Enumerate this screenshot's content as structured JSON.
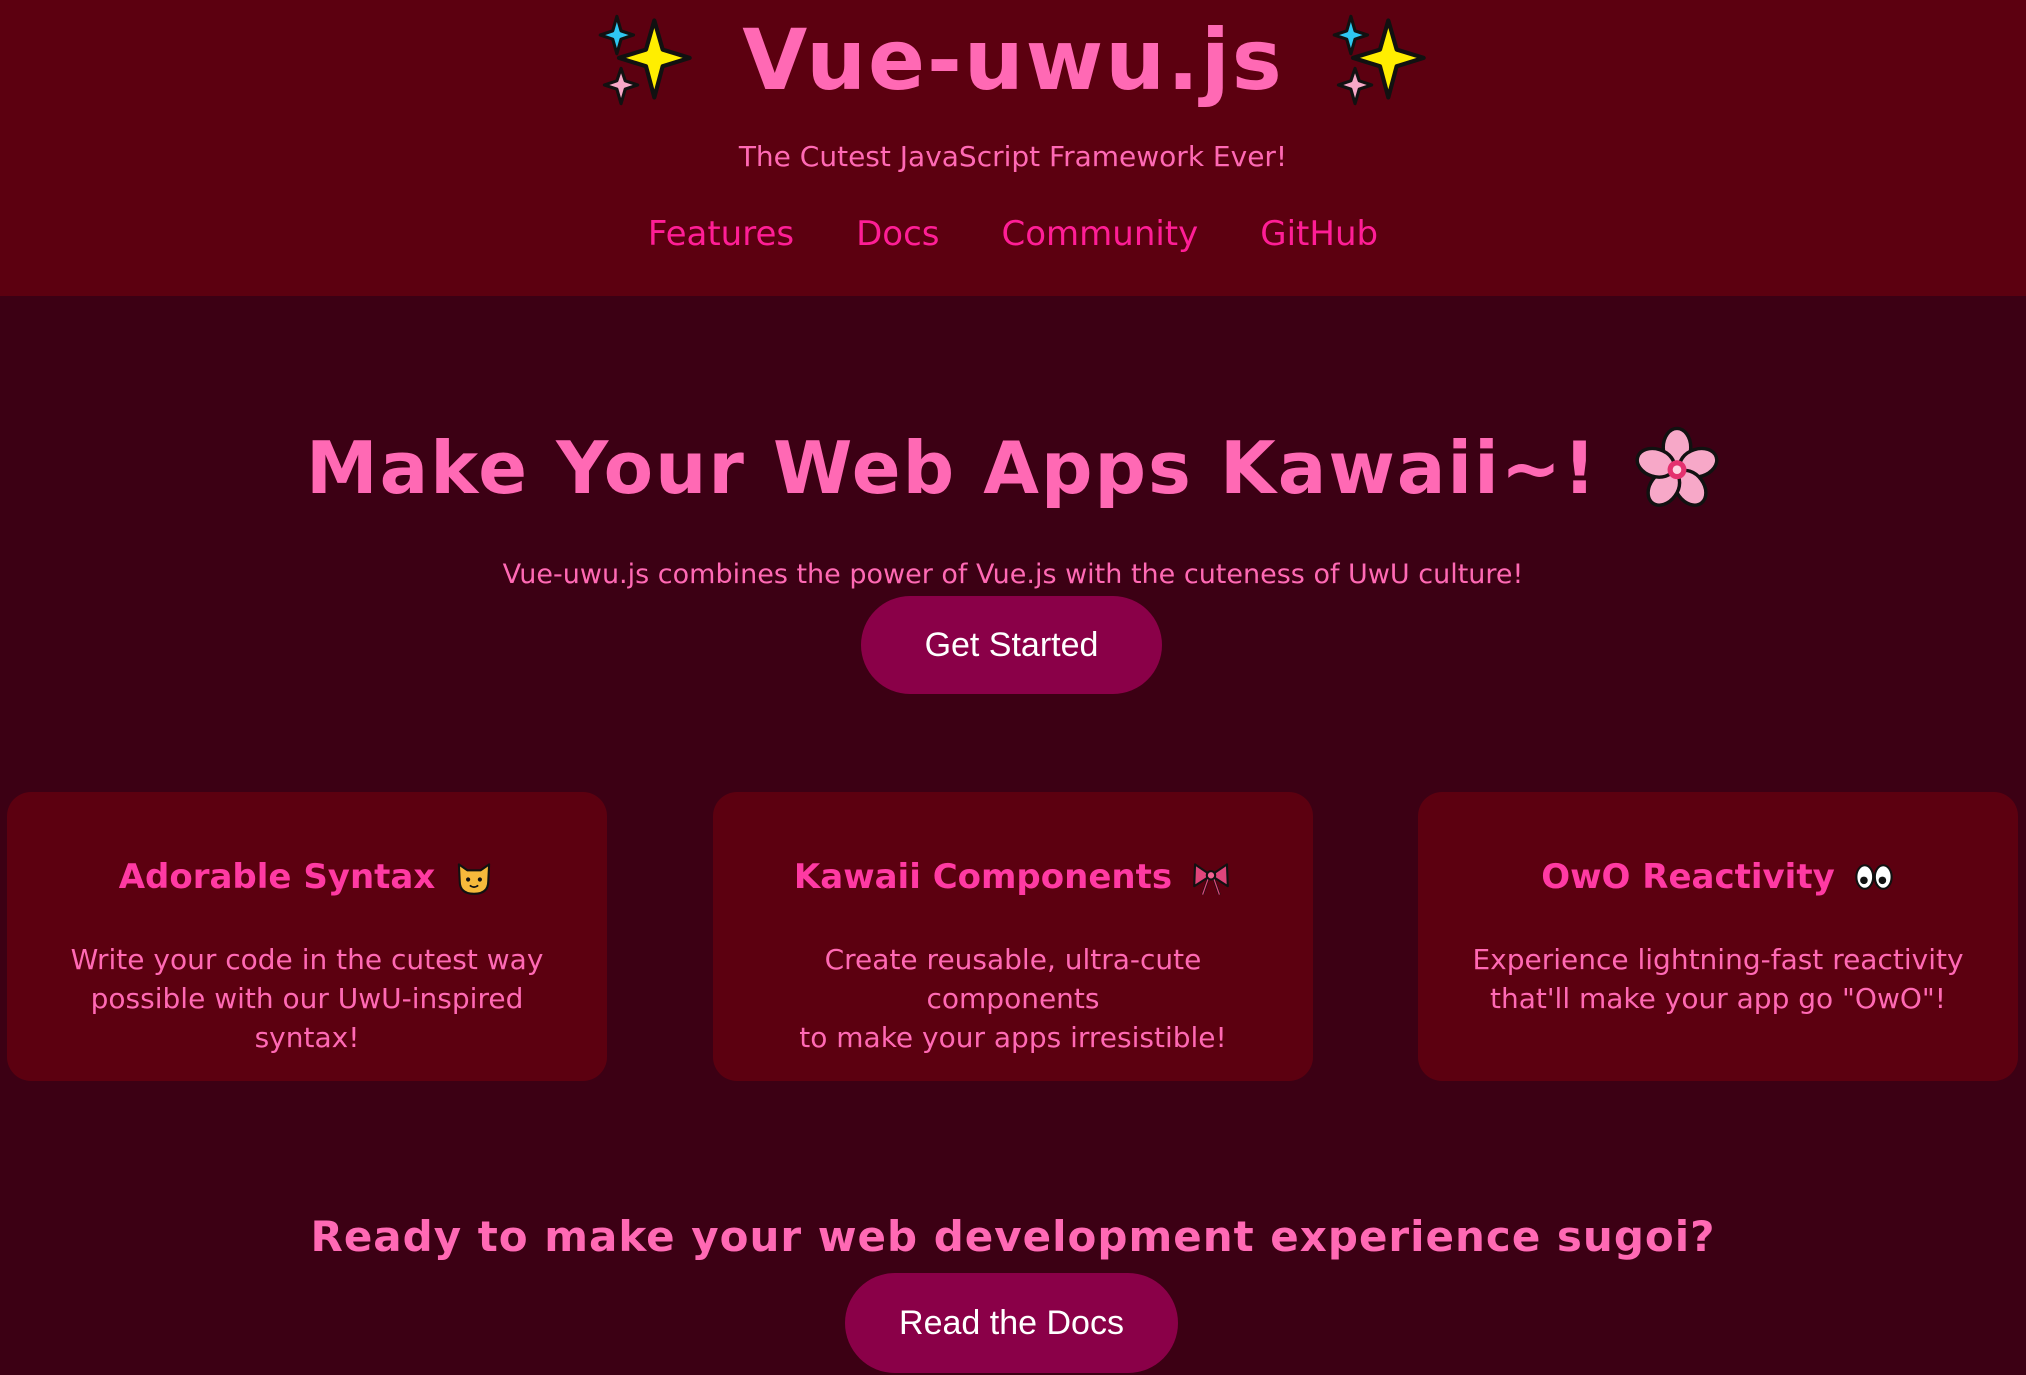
{
  "header": {
    "logo_text": "Vue-uwu.js",
    "logo_icon": "sparkles-icon",
    "tagline": "The Cutest JavaScript Framework Ever!",
    "nav": [
      "Features",
      "Docs",
      "Community",
      "GitHub"
    ]
  },
  "hero": {
    "title": "Make Your Web Apps Kawaii~!",
    "title_icon": "cherry-blossom-icon",
    "subtitle": "Vue-uwu.js combines the power of Vue.js with the cuteness of UwU culture!",
    "cta_label": "Get Started"
  },
  "features": [
    {
      "title": "Adorable Syntax",
      "icon": "cat-face-icon",
      "lines": [
        "Write your code in the cutest way",
        "possible with our UwU-inspired syntax!"
      ]
    },
    {
      "title": "Kawaii Components",
      "icon": "ribbon-icon",
      "lines": [
        "Create reusable, ultra-cute components",
        "to make your apps irresistible!"
      ]
    },
    {
      "title": "OwO Reactivity",
      "icon": "eyes-icon",
      "lines": [
        "Experience lightning-fast reactivity",
        "that'll make your app go \"OwO\"!"
      ]
    }
  ],
  "cta": {
    "title": "Ready to make your web development experience sugoi?",
    "button_label": "Read the Docs"
  },
  "colors": {
    "header_bg": "#5c0010",
    "page_bg": "#3c0014",
    "accent_pink": "#ff69b4",
    "nav_pink": "#ff1e96",
    "button_bg": "#8a0048"
  }
}
